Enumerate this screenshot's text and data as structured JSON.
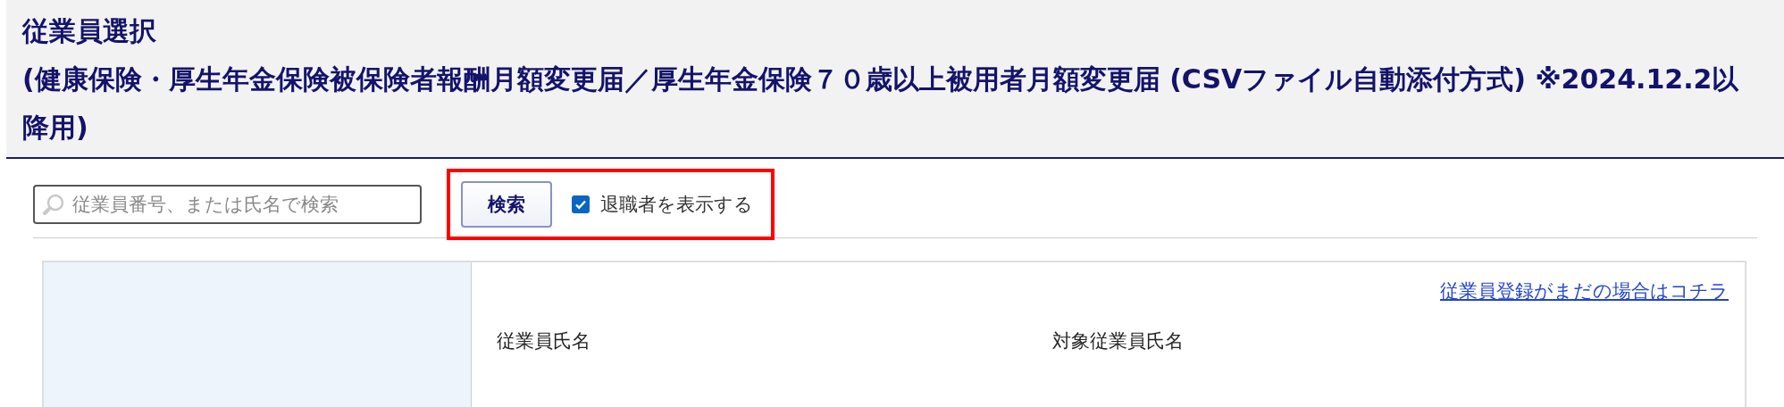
{
  "header": {
    "title": "従業員選択",
    "subtitle": "(健康保険・厚生年金保険被保険者報酬月額変更届／厚生年金保険７０歳以上被用者月額変更届 (CSVファイル自動添付方式) ※2024.12.2以降用)"
  },
  "search": {
    "placeholder": "従業員番号、または氏名で検索",
    "button": "検索",
    "show_retired": {
      "label": "退職者を表示する",
      "checked": true
    },
    "highlighted": true
  },
  "panel": {
    "register_link": "従業員登録がまだの場合はコチラ",
    "labels": [
      "従業員氏名",
      "対象従業員氏名"
    ]
  }
}
